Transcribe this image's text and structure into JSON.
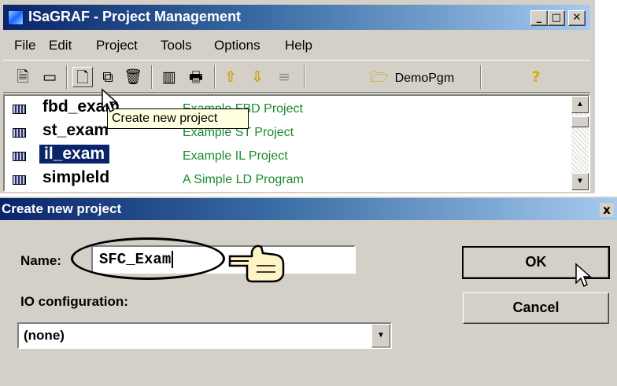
{
  "window": {
    "title": "ISaGRAF - Project Management",
    "controls": {
      "minimize": "_",
      "maximize": "□",
      "close": "✕"
    }
  },
  "menu": [
    "File",
    "Edit",
    "Project",
    "Tools",
    "Options",
    "Help"
  ],
  "toolbar": {
    "program_label": "DemoPgm",
    "tooltip": "Create new project"
  },
  "projects": [
    {
      "name": "fbd_exam",
      "description": "Example FBD Project"
    },
    {
      "name": "st_exam",
      "description": "Example ST Project"
    },
    {
      "name": "il_exam",
      "description": "Example IL Project",
      "selected": true
    },
    {
      "name": "simpleld",
      "description": "A Simple LD Program"
    }
  ],
  "dialog": {
    "title": "Create new project",
    "close": "x",
    "name_label": "Name:",
    "name_value": "SFC_Exam",
    "io_label": "IO configuration:",
    "io_value": "(none)",
    "ok_label": "OK",
    "cancel_label": "Cancel"
  },
  "colors": {
    "title_start": "#0a246a",
    "title_end": "#a6caf0",
    "description_text": "#1a8a2a",
    "face": "#d4d0c8"
  }
}
